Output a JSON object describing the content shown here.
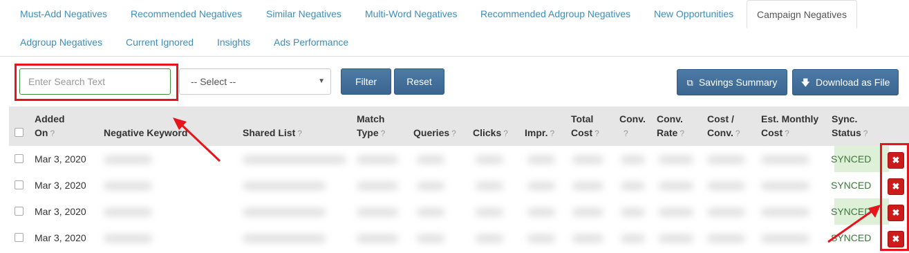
{
  "tabs": [
    {
      "label": "Must-Add Negatives"
    },
    {
      "label": "Recommended Negatives"
    },
    {
      "label": "Similar Negatives"
    },
    {
      "label": "Multi-Word Negatives"
    },
    {
      "label": "Recommended Adgroup Negatives"
    },
    {
      "label": "New Opportunities"
    },
    {
      "label": "Campaign Negatives",
      "active": true
    },
    {
      "label": "Adgroup Negatives"
    },
    {
      "label": "Current Ignored"
    },
    {
      "label": "Insights"
    },
    {
      "label": "Ads Performance"
    }
  ],
  "toolbar": {
    "search_placeholder": "Enter Search Text",
    "select_value": "-- Select --",
    "filter_label": "Filter",
    "reset_label": "Reset",
    "savings_label": "Savings Summary",
    "download_label": "Download as File"
  },
  "columns": {
    "added_on": [
      "Added",
      "On"
    ],
    "negative_keyword": "Negative Keyword",
    "shared_list": "Shared List",
    "match_type": [
      "Match",
      "Type"
    ],
    "queries": "Queries",
    "clicks": "Clicks",
    "impr": "Impr.",
    "total_cost": [
      "Total",
      "Cost"
    ],
    "conv": "Conv.",
    "conv_rate": [
      "Conv.",
      "Rate"
    ],
    "cost_conv": [
      "Cost /",
      "Conv."
    ],
    "est_monthly_cost": [
      "Est. Monthly",
      "Cost"
    ],
    "sync_status": [
      "Sync.",
      "Status"
    ],
    "help_mark": "?"
  },
  "rows": [
    {
      "added_on": "Mar 3, 2020",
      "sync_status": "SYNCED",
      "sync_highlight": true
    },
    {
      "added_on": "Mar 3, 2020",
      "sync_status": "SYNCED",
      "sync_highlight": false
    },
    {
      "added_on": "Mar 3, 2020",
      "sync_status": "SYNCED",
      "sync_highlight": true
    },
    {
      "added_on": "Mar 3, 2020",
      "sync_status": "SYNCED",
      "sync_highlight": false
    }
  ],
  "delete_icon": "close-icon",
  "colors": {
    "link": "#3c8dbc",
    "button": "#3a6690",
    "synced_bg": "#dff0d8",
    "synced_text": "#3c763d",
    "delete": "#cc1b1b",
    "annotation": "#e8141c"
  }
}
